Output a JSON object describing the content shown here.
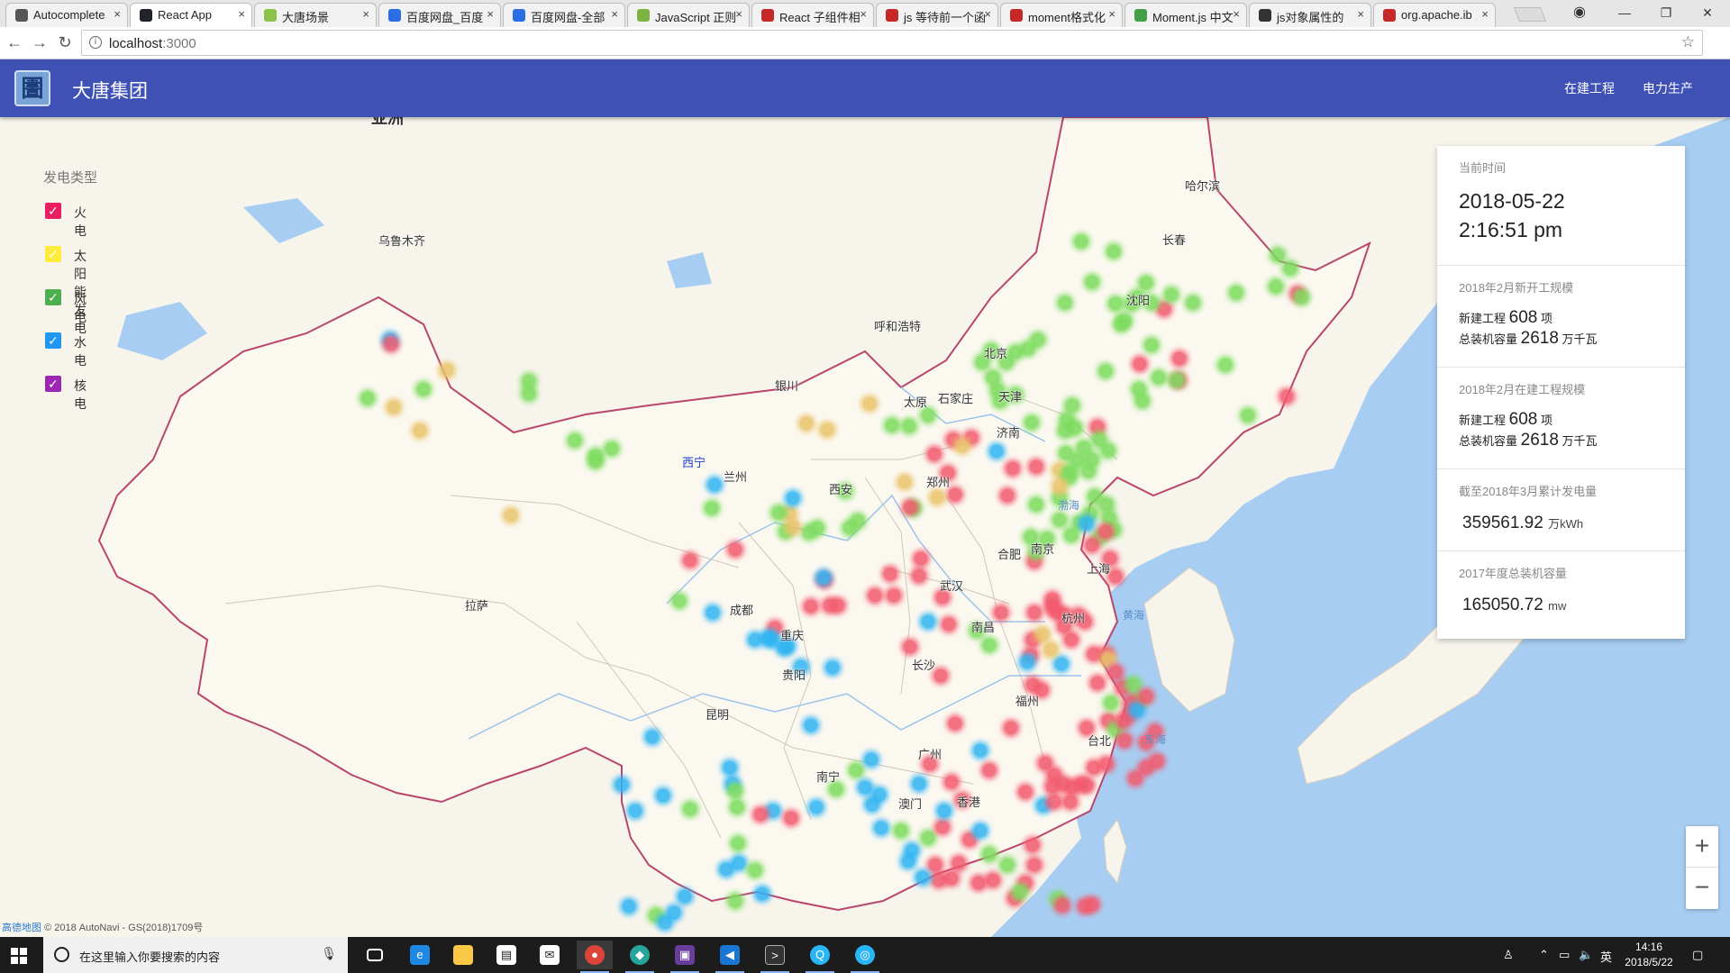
{
  "browser": {
    "tabs": [
      {
        "title": "Autocomplete",
        "color": "#555555",
        "active": false
      },
      {
        "title": "React App",
        "color": "#20232a",
        "active": true
      },
      {
        "title": "大唐场景",
        "color": "#8bc34a",
        "active": false
      },
      {
        "title": "百度网盘_百度",
        "color": "#2b6de5",
        "active": false
      },
      {
        "title": "百度网盘-全部",
        "color": "#2b6de5",
        "active": false
      },
      {
        "title": "JavaScript 正则",
        "color": "#7cb342",
        "active": false
      },
      {
        "title": "React 子组件相",
        "color": "#c62828",
        "active": false
      },
      {
        "title": "js 等待前一个函",
        "color": "#c62828",
        "active": false
      },
      {
        "title": "moment格式化",
        "color": "#c62828",
        "active": false
      },
      {
        "title": "Moment.js 中文",
        "color": "#43a047",
        "active": false
      },
      {
        "title": "js对象属性的",
        "color": "#333333",
        "active": false
      },
      {
        "title": "org.apache.ib",
        "color": "#c62828",
        "active": false
      }
    ],
    "url_host": "localhost",
    "url_port": ":3000",
    "window_controls": [
      "—",
      "❐",
      "✕"
    ]
  },
  "app": {
    "logo_char": "圕",
    "title": "大唐集团",
    "nav": [
      "在建工程",
      "电力生产"
    ]
  },
  "legend": {
    "title": "发电类型",
    "items": [
      {
        "label": "火电",
        "color": "#e91e63"
      },
      {
        "label": "太阳能发电",
        "color": "#ffeb3b"
      },
      {
        "label": "风电",
        "color": "#4caf50"
      },
      {
        "label": "水电",
        "color": "#2196f3"
      },
      {
        "label": "核电",
        "color": "#9c27b0"
      }
    ]
  },
  "info_panel": {
    "current_time_label": "当前时间",
    "date": "2018-05-22",
    "time": "2:16:51 pm",
    "new_start": {
      "label": "2018年2月新开工规模",
      "projects_label": "新建工程",
      "projects_value": "608",
      "projects_unit": "项",
      "capacity_label": "总装机容量",
      "capacity_value": "2618",
      "capacity_unit": "万千瓦"
    },
    "in_progress": {
      "label": "2018年2月在建工程规模",
      "projects_label": "新建工程",
      "projects_value": "608",
      "projects_unit": "项",
      "capacity_label": "总装机容量",
      "capacity_value": "2618",
      "capacity_unit": "万千瓦"
    },
    "generation": {
      "label": "截至2018年3月累计发电量",
      "value": "359561.92",
      "unit": "万kWh"
    },
    "capacity_2017": {
      "label": "2017年度总装机容量",
      "value": "165050.72",
      "unit": "mw"
    }
  },
  "map": {
    "region_label": "亚洲",
    "cities": [
      "乌鲁木齐",
      "哈尔滨",
      "长春",
      "沈阳",
      "呼和浩特",
      "北京",
      "天津",
      "石家庄",
      "太原",
      "银川",
      "西宁",
      "兰州",
      "济南",
      "西安",
      "郑州",
      "合肥",
      "南京",
      "上海",
      "武汉",
      "成都",
      "重庆",
      "杭州",
      "拉萨",
      "南昌",
      "长沙",
      "贵阳",
      "昆明",
      "福州",
      "台北",
      "广州",
      "南宁",
      "澳门",
      "香港"
    ],
    "seas": [
      "渤海",
      "黄海",
      "东海"
    ],
    "attribution_logo": "高德地图",
    "attribution": "© 2018 AutoNavi - GS(2018)1709号",
    "zoom_in": "+",
    "zoom_out": "−"
  },
  "taskbar": {
    "search_placeholder": "在这里输入你要搜索的内容",
    "ime": "英",
    "time": "14:16",
    "date": "2018/5/22"
  }
}
